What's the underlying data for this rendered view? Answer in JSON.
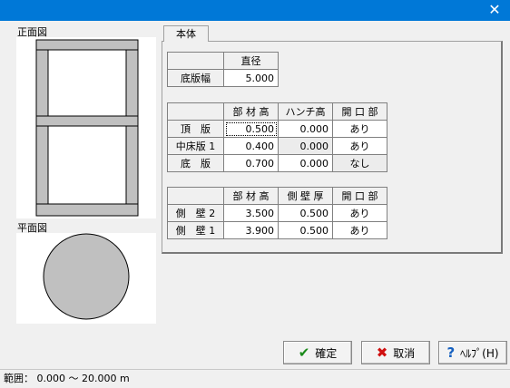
{
  "window": {
    "close_glyph": "✕"
  },
  "front_view": {
    "label": "正面図"
  },
  "plan_view": {
    "label": "平面図"
  },
  "tab": {
    "label": "本体"
  },
  "base_table": {
    "col_header": "直径",
    "row_label": "底版幅",
    "value": "5.000"
  },
  "slab_table": {
    "headers": [
      "部 材 高",
      "ハンチ高",
      "開 口 部"
    ],
    "rows": [
      {
        "label": "頂　版",
        "height": "0.500",
        "haunch": "0.000",
        "opening": "あり"
      },
      {
        "label": "中床版 1",
        "height": "0.400",
        "haunch": "0.000",
        "opening": "あり"
      },
      {
        "label": "底　版",
        "height": "0.700",
        "haunch": "0.000",
        "opening": "なし"
      }
    ]
  },
  "wall_table": {
    "headers": [
      "部 材 高",
      "側 壁 厚",
      "開 口 部"
    ],
    "rows": [
      {
        "label": "側　壁 2",
        "height": "3.500",
        "thickness": "0.500",
        "opening": "あり"
      },
      {
        "label": "側　壁 1",
        "height": "3.900",
        "thickness": "0.500",
        "opening": "あり"
      }
    ]
  },
  "buttons": {
    "ok": {
      "label": "確定",
      "icon": "check-icon"
    },
    "cancel": {
      "label": "取消",
      "icon": "x-icon"
    },
    "help": {
      "label": "ﾍﾙﾌﾟ(H)",
      "icon": "question-icon"
    }
  },
  "status": {
    "range_text": "範囲： 0.000 ～ 20.000 m"
  },
  "colors": {
    "titlebar": "#0078d7",
    "member_fill": "#c0c0c0",
    "ok_icon": "#1a8a1a",
    "cancel_icon": "#d01010",
    "help_icon": "#1560c0"
  }
}
